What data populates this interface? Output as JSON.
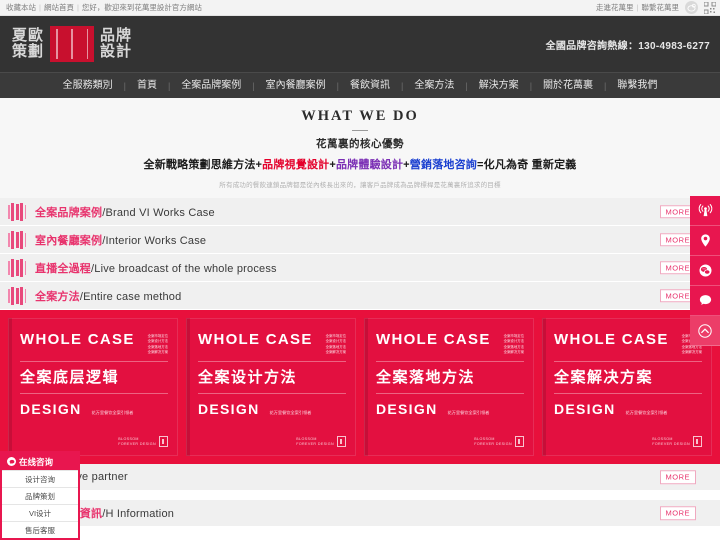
{
  "topbar": {
    "links": [
      "收藏本站",
      "網站首頁"
    ],
    "greeting": "您好，歡迎來到花萬里設計官方網站",
    "right_links": [
      "走進花萬里",
      "聯繫花萬里"
    ],
    "icons": [
      "weibo-icon",
      "qr-code-icon"
    ]
  },
  "header": {
    "logo": {
      "left_top": "夏歐",
      "left_bottom": "策劃",
      "right_top": "品牌",
      "right_bottom": "設計",
      "mark_color": "#c8102e"
    },
    "hotline": "全國品牌咨詢熱線：130-4983-6277"
  },
  "nav": {
    "items": [
      "全服務類別",
      "首頁",
      "全案品牌案例",
      "室內餐廳案例",
      "餐飲資訊",
      "全案方法",
      "解決方案",
      "關於花萬裏",
      "聯繫我們"
    ],
    "separator": "|"
  },
  "what_we_do": {
    "title": "WHAT WE DO",
    "subtitle": "花萬裏的核心優勢",
    "formula": {
      "part1": "全新戰略策劃思維方法+",
      "part2": "品牌視覺設計",
      "plus1": "+",
      "part3": "品牌體驗設計",
      "plus2": "+",
      "part4": "營銷落地咨詢",
      "part5": "=化凡為奇 重新定義"
    },
    "note": "所有成功的餐飲連鎖品牌都是從內核長出來的，讓客戶品牌成為品牌標桿是花萬裏所追求的目標"
  },
  "sections": [
    {
      "cn": "全案品牌案例",
      "en": "/Brand VI Works Case",
      "more": "MORE"
    },
    {
      "cn": "室內餐廳案例",
      "en": "/Interior Works Case",
      "more": "MORE"
    },
    {
      "cn": "直播全過程",
      "en": "/Live broadcast of the whole process",
      "more": "MORE"
    },
    {
      "cn": "全案方法",
      "en": "/Entire case method",
      "more": "MORE"
    }
  ],
  "gallery": {
    "cards": [
      {
        "title_en": "WHOLE CASE",
        "title_cn": "全案底层逻辑",
        "design": "DESIGN",
        "tag": "花万里餐饮全案引领者",
        "mini": [
          "全案市场定位",
          "全案设计方法",
          "全案落地方法",
          "全案解决方案"
        ],
        "mark_line1": "BLOSSOM",
        "mark_line2": "FOREVER DESIGN"
      },
      {
        "title_en": "WHOLE CASE",
        "title_cn": "全案设计方法",
        "design": "DESIGN",
        "tag": "花万里餐饮全案引领者",
        "mini": [
          "全案市场定位",
          "全案设计方法",
          "全案落地方法",
          "全案解决方案"
        ],
        "mark_line1": "BLOSSOM",
        "mark_line2": "FOREVER DESIGN"
      },
      {
        "title_en": "WHOLE CASE",
        "title_cn": "全案落地方法",
        "design": "DESIGN",
        "tag": "花万里餐饮全案引领者",
        "mini": [
          "全案市场定位",
          "全案设计方法",
          "全案落地方法",
          "全案解决方案"
        ],
        "mark_line1": "BLOSSOM",
        "mark_line2": "FOREVER DESIGN"
      },
      {
        "title_en": "WHOLE CASE",
        "title_cn": "全案解决方案",
        "design": "DESIGN",
        "tag": "花万里餐饮全案引领者",
        "mini": [
          "全案市场定位",
          "全案设计方法",
          "全案落地方法",
          "全案解决方案"
        ],
        "mark_line1": "BLOSSOM",
        "mark_line2": "FOREVER DESIGN"
      }
    ]
  },
  "bottom_sections": [
    {
      "cn": "",
      "en": "ooperative partner",
      "more": "MORE"
    },
    {
      "cn": "營銷設計資訊",
      "en": "/H Information",
      "more": "MORE"
    }
  ],
  "dock": {
    "items": [
      "broadcast-icon",
      "location-pin-icon",
      "wechat-icon",
      "chat-bubble-icon",
      "scroll-to-top-icon"
    ]
  },
  "chat_widget": {
    "header": "在线咨询",
    "items": [
      "设计咨询",
      "品牌策划",
      "VI设计",
      "售后客服"
    ]
  },
  "colors": {
    "brand_red": "#e8164f",
    "accent_pink": "#e8336d",
    "header_dark": "#333333",
    "card_red": "#e31040"
  }
}
